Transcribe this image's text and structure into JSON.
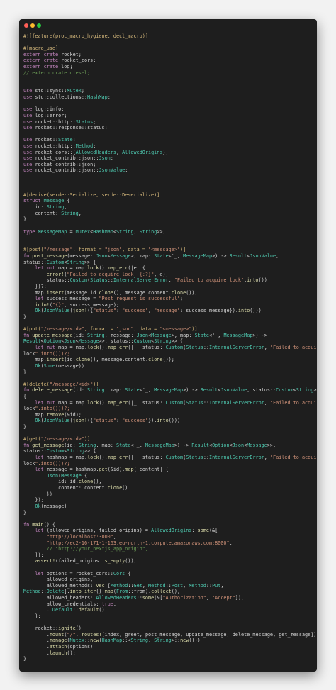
{
  "window": {
    "title_buttons": [
      "close",
      "minimize",
      "zoom"
    ],
    "colors": {
      "close": "#ff5f57",
      "minimize": "#febc2e",
      "zoom": "#28c840",
      "background": "#1e1e1e"
    }
  },
  "editor": {
    "language": "rust",
    "lines": [
      "#![feature(proc_macro_hygiene, decl_macro)]",
      "",
      "#[macro_use]",
      "extern crate rocket;",
      "extern crate rocket_cors;",
      "extern crate log;",
      "// extern crate diesel;",
      "",
      "",
      "use std::sync::Mutex;",
      "use std::collections::HashMap;",
      "",
      "use log::info;",
      "use log::error;",
      "use rocket::http::Status;",
      "use rocket::response::status;",
      "",
      "use rocket::State;",
      "use rocket::http::Method;",
      "use rocket_cors::{AllowedHeaders, AllowedOrigins};",
      "use rocket_contrib::json::Json;",
      "use rocket_contrib::json;",
      "use rocket_contrib::json::JsonValue;",
      "",
      "",
      "",
      "#[derive(serde::Serialize, serde::Deserialize)]",
      "struct Message {",
      "    id: String,",
      "    content: String,",
      "}",
      "",
      "type MessageMap = Mutex<HashMap<String, String>>;",
      "",
      "",
      "#[post(\"/message\", format = \"json\", data = \"<message>\")]",
      "fn post_message(message: Json<Message>, map: State<'_, MessageMap>) -> Result<JsonValue,",
      "status::Custom<String>> {",
      "    let mut map = map.lock().map_err(|e| {",
      "        error!(\"Failed to acquire lock: {:?}\", e);",
      "        status::Custom(Status::InternalServerError, \"Failed to acquire lock\".into())",
      "    })?;",
      "    map.insert(message.id.clone(), message.content.clone());",
      "    let success_message = \"Post request is successful\";",
      "    info!(\"{}\", success_message);",
      "    Ok(JsonValue(json!({\"status\": \"success\", \"message\": success_message}).into()))",
      "}",
      "",
      "#[put(\"/message/<id>\", format = \"json\", data = \"<message>\")]",
      "fn update_message(id: String, message: Json<Message>, map: State<'_, MessageMap>) ->",
      "Result<Option<Json<Message>>, status::Custom<String>> {",
      "    let mut map = map.lock().map_err(|_| status::Custom(Status::InternalServerError, \"Failed to acquire",
      "lock\".into()))?;",
      "    map.insert(id.clone(), message.content.clone());",
      "    Ok(Some(message))",
      "}",
      "",
      "#[delete(\"/message/<id>\")]",
      "fn delete_message(id: String, map: State<'_, MessageMap>) -> Result<JsonValue, status::Custom<String>>",
      "{",
      "    let mut map = map.lock().map_err(|_| status::Custom(Status::InternalServerError, \"Failed to acquire",
      "lock\".into()))?;",
      "    map.remove(&id);",
      "    Ok(JsonValue(json!({\"status\": \"success\"}).into()))",
      "}",
      "",
      "#[get(\"/message/<id>\")]",
      "fn get_message(id: String, map: State<'_, MessageMap>) -> Result<Option<Json<Message>>,",
      "status::Custom<String>> {",
      "    let hashmap = map.lock().map_err(|_| status::Custom(Status::InternalServerError, \"Failed to acquire",
      "lock\".into()))?;",
      "    let message = hashmap.get(&id).map(|content| {",
      "        Json(Message {",
      "            id: id.clone(),",
      "            content: content.clone()",
      "        })",
      "    });",
      "    Ok(message)",
      "}",
      "",
      "fn main() {",
      "    let (allowed_origins, failed_origins) = AllowedOrigins::some(&[",
      "        \"http://localhost:3000\",",
      "        \"http://ec2-16-171-1-163.eu-north-1.compute.amazonaws.com:8000\",",
      "        // \"http://your_nextjs_app_origin\",",
      "    ]);",
      "    assert!(failed_origins.is_empty());",
      "",
      "    let options = rocket_cors::Cors {",
      "        allowed_origins,",
      "        allowed_methods: vec![Method::Get, Method::Post, Method::Put,",
      "Method::Delete].into_iter().map(From::from).collect(),",
      "        allowed_headers: AllowedHeaders::some(&[\"Authorization\", \"Accept\"]),",
      "        allow_credentials: true,",
      "        ..Default::default()",
      "    };",
      "",
      "    rocket::ignite()",
      "        .mount(\"/\", routes![index, greet, post_message, update_message, delete_message, get_message])",
      "        .manage(Mutex::new(HashMap::<String, String>::new()))",
      "        .attach(options)",
      "        .launch();",
      "}"
    ]
  }
}
